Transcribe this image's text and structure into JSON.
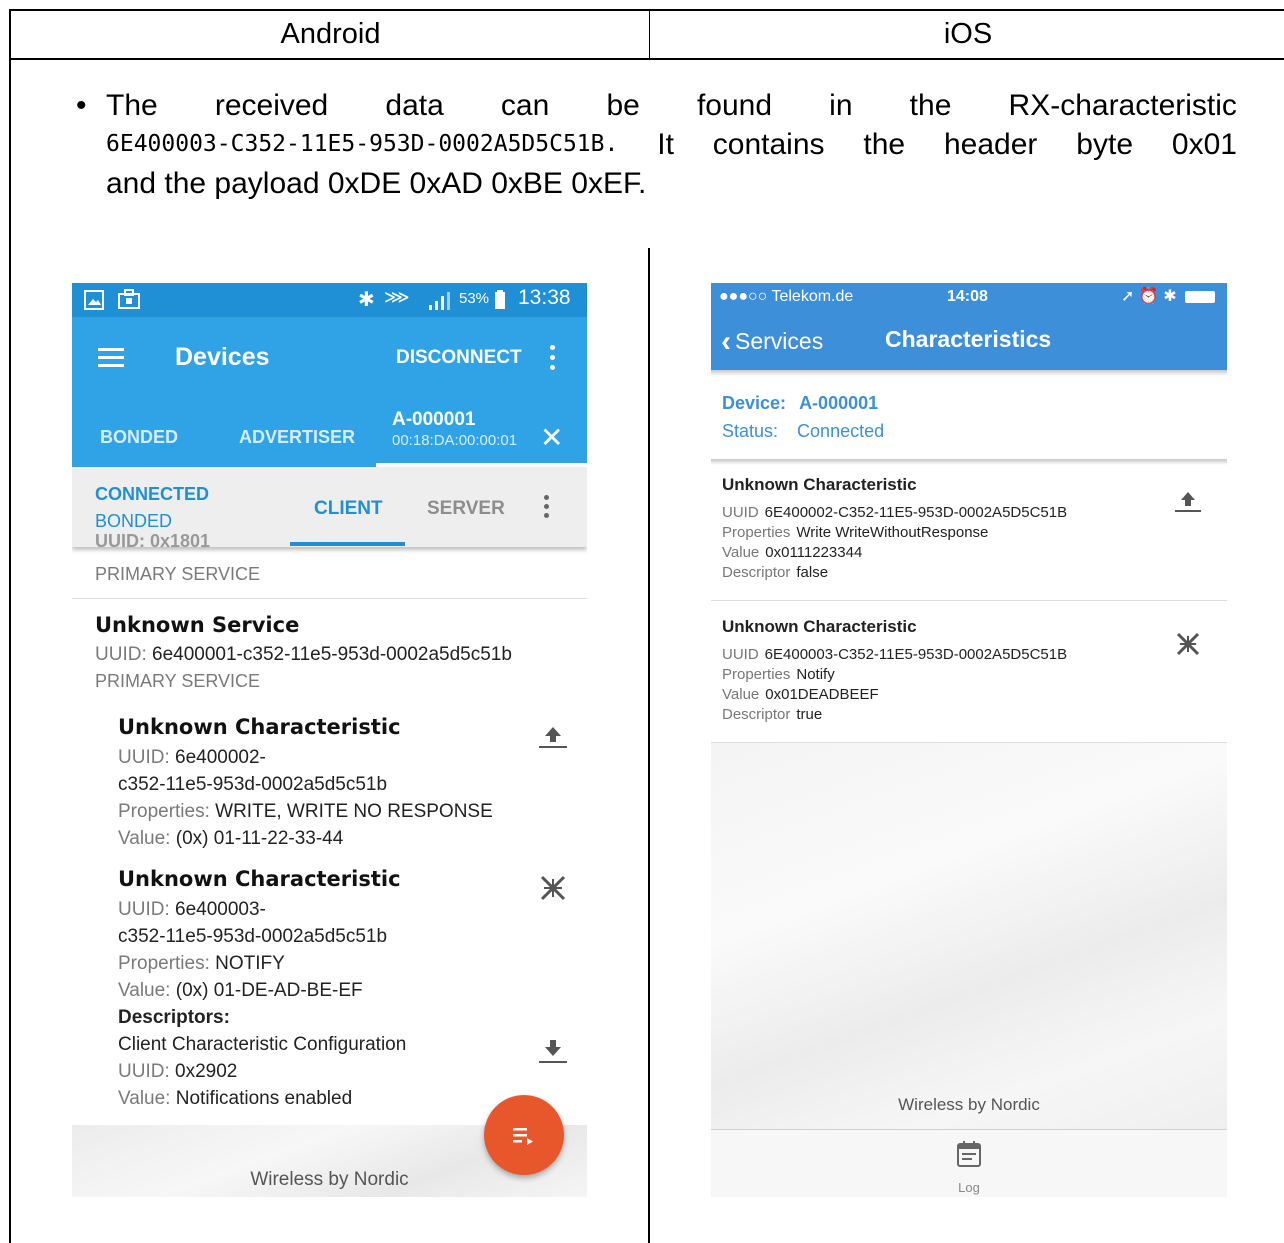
{
  "table": {
    "col_android": "Android",
    "col_ios": "iOS"
  },
  "paragraph": {
    "bullet": "•",
    "line1_words": [
      "The",
      "received",
      "data",
      "can",
      "be",
      "found",
      "in",
      "the",
      "RX-characteristic"
    ],
    "uuid": "6E400003-C352-11E5-953D-0002A5D5C51B.",
    "line2_words": [
      "It",
      "contains",
      "the",
      "header",
      "byte",
      "0x01"
    ],
    "line3": "and the payload 0xDE 0xAD 0xBE 0xEF."
  },
  "android": {
    "status": {
      "battery": "53%",
      "time": "13:38"
    },
    "appbar": {
      "title": "Devices",
      "disconnect": "DISCONNECT"
    },
    "tabs": {
      "bonded": "BONDED",
      "advertiser": "ADVERTISER",
      "active_name": "A-000001",
      "active_mac": "00:18:DA:00:00:01"
    },
    "subbar": {
      "connected": "CONNECTED",
      "bonded": "BONDED",
      "client": "CLIENT",
      "server": "SERVER"
    },
    "prev_service": {
      "uuid_cut": "UUID: 0x1801",
      "type": "PRIMARY SERVICE"
    },
    "service": {
      "name": "Unknown Service",
      "uuid_label": "UUID:",
      "uuid_value": "6e400001-c352-11e5-953d-0002a5d5c51b",
      "type": "PRIMARY SERVICE"
    },
    "char1": {
      "name": "Unknown Characteristic",
      "uuid_label": "UUID:",
      "uuid_value1": "6e400002-",
      "uuid_value2": "c352-11e5-953d-0002a5d5c51b",
      "props_label": "Properties:",
      "props_value": "WRITE, WRITE NO RESPONSE",
      "value_label": "Value:",
      "value_value": "(0x) 01-11-22-33-44"
    },
    "char2": {
      "name": "Unknown Characteristic",
      "uuid_label": "UUID:",
      "uuid_value1": "6e400003-",
      "uuid_value2": "c352-11e5-953d-0002a5d5c51b",
      "props_label": "Properties:",
      "props_value": "NOTIFY",
      "value_label": "Value:",
      "value_value": "(0x) 01-DE-AD-BE-EF",
      "descriptors_label": "Descriptors:",
      "desc_name": "Client Characteristic Configuration",
      "desc_uuid_label": "UUID:",
      "desc_uuid_value": "0x2902",
      "desc_value_label": "Value:",
      "desc_value_value": "Notifications enabled"
    },
    "footer": "Wireless by Nordic"
  },
  "ios": {
    "status": {
      "carrier": "●●●○○ Telekom.de",
      "time": "14:08"
    },
    "nav": {
      "back": "Services",
      "title": "Characteristics"
    },
    "device_label": "Device:",
    "device_value": "A-000001",
    "status_label": "Status:",
    "status_value": "Connected",
    "char1": {
      "name": "Unknown Characteristic",
      "uuid_label": "UUID",
      "uuid_value": "6E400002-C352-11E5-953D-0002A5D5C51B",
      "props_label": "Properties",
      "props_value": "Write WriteWithoutResponse",
      "value_label": "Value",
      "value_value": "0x0111223344",
      "desc_label": "Descriptor",
      "desc_value": "false"
    },
    "char2": {
      "name": "Unknown Characteristic",
      "uuid_label": "UUID",
      "uuid_value": "6E400003-C352-11E5-953D-0002A5D5C51B",
      "props_label": "Properties",
      "props_value": "Notify",
      "value_label": "Value",
      "value_value": "0x01DEADBEEF",
      "desc_label": "Descriptor",
      "desc_value": "true"
    },
    "footer": "Wireless by Nordic",
    "tab_log": "Log"
  },
  "colors": {
    "android_primary": "#2fa3e6",
    "android_status": "#1f8fd6",
    "android_fab": "#e8572b",
    "ios_primary": "#3d8fd9",
    "header_gray": "#d7d7d7"
  },
  "icons": {
    "upload": "upload-icon",
    "notify": "notify-icon",
    "download": "download-icon",
    "log": "log-icon",
    "menu": "menu-icon",
    "more": "more-vert-icon",
    "close": "close-icon",
    "bluetooth": "bluetooth-icon",
    "back": "chevron-left-icon"
  }
}
